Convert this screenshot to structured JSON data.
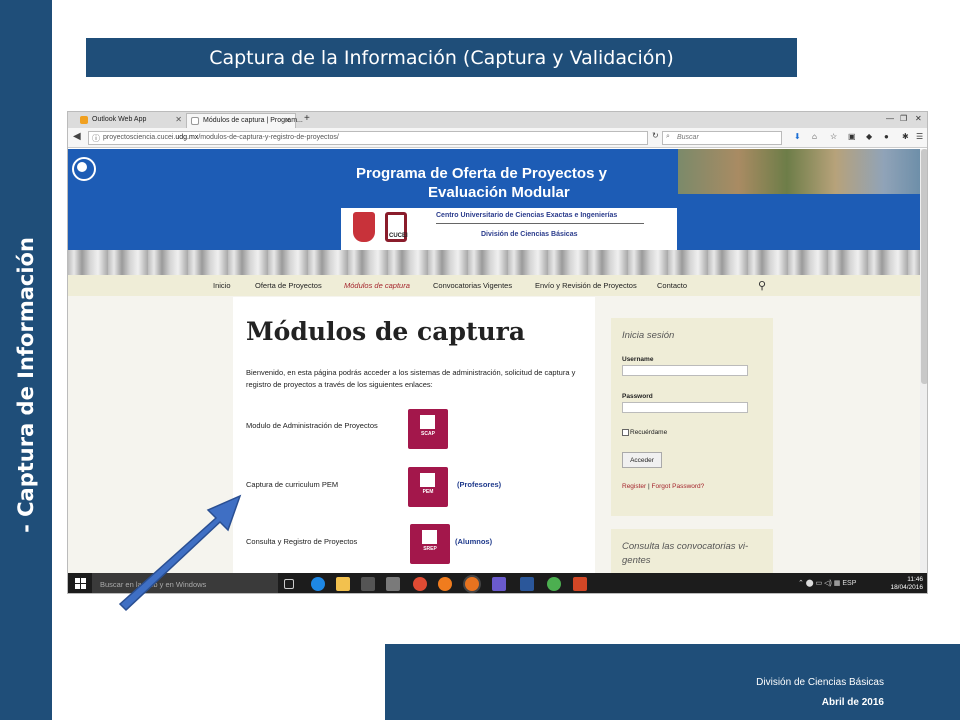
{
  "slide": {
    "vertical_title": "- Captura de Información",
    "title": "Captura de la Información (Captura y Validación)",
    "footer_line1": "División de Ciencias Básicas",
    "footer_line2": "Abril de 2016"
  },
  "browser": {
    "tabs": [
      {
        "label": "Outlook Web App"
      },
      {
        "label": "Módulos de captura | Program..."
      }
    ],
    "url_prefix": "proyectosciencia.cucei.",
    "url_domain": "udg.mx",
    "url_path": "/modulos-de-captura-y-registro-de-proyectos/",
    "search_placeholder": "Buscar"
  },
  "site": {
    "title_line1": "Programa de Oferta de Proyectos y",
    "title_line2": "Evaluación Modular",
    "cucei_logo_text": "CUCEI",
    "center_name": "Centro Universitario de Ciencias Exactas e Ingenierías",
    "division_name": "División de Ciencias Básicas",
    "menu": [
      "Inicio",
      "Oferta de Proyectos",
      "Módulos de captura",
      "Convocatorias Vigentes",
      "Envío y Revisión de Proyectos",
      "Contacto"
    ],
    "heading": "Módulos de captura",
    "intro": "Bienvenido, en esta página podrás acceder a los sistemas de administración, solicitud de captura y registro de proyectos a través de los siguientes enlaces:",
    "modules": [
      {
        "label": "Modulo de Administración de Proyectos",
        "icon_text": "SCAP",
        "note": ""
      },
      {
        "label": "Captura de curriculum PEM",
        "icon_text": "PEM",
        "note": "(Profesores)"
      },
      {
        "label": "Consulta y Registro de Proyectos",
        "icon_text": "SREP",
        "note": "(Alumnos)"
      }
    ],
    "login": {
      "heading": "Inicia sesión",
      "username_label": "Username",
      "password_label": "Password",
      "remember_label": "Recuérdame",
      "button": "Acceder",
      "register_link": "Register",
      "separator": " | ",
      "forgot_link": "Forgot Password?"
    },
    "calls_heading": "Consulta las convocatorias vi-gentes"
  },
  "taskbar": {
    "search_placeholder": "Buscar en la web y en Windows",
    "language": "ESP",
    "time": "11:46",
    "date": "18/04/2016"
  }
}
